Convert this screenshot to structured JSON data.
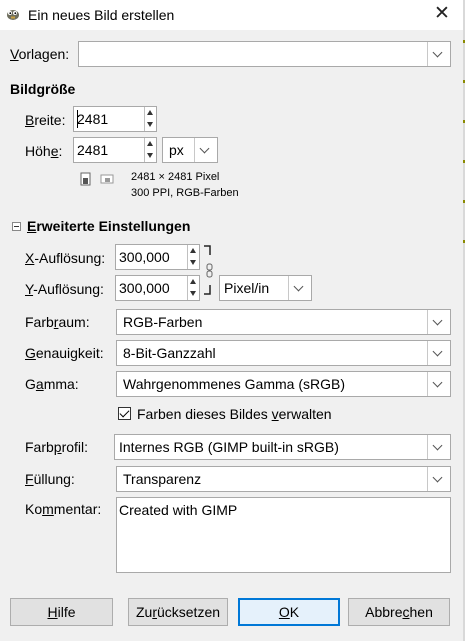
{
  "window": {
    "title": "Ein neues Bild erstellen"
  },
  "template": {
    "label_prefix": "V",
    "label_rest": "orlagen:",
    "value": ""
  },
  "image_size": {
    "heading": "Bildgröße",
    "width_label_prefix": "B",
    "width_label_rest": "reite:",
    "width_value": "2481",
    "height_label_prefix": "Höh",
    "height_label_mid": "e",
    "height_label_rest": ":",
    "height_value": "2481",
    "unit": "px",
    "info_line1": "2481 × 2481 Pixel",
    "info_line2": "300 PPI, RGB-Farben"
  },
  "advanced": {
    "heading_prefix": "E",
    "heading_rest": "rweiterte Einstellungen",
    "xres_label_prefix": "X",
    "xres_label_rest": "-Auflösung:",
    "xres_value": "300,000",
    "yres_label_prefix": "Y",
    "yres_label_rest": "-Auflösung:",
    "yres_value": "300,000",
    "res_unit": "Pixel/in",
    "colorspace_label_a": "Farb",
    "colorspace_label_u": "r",
    "colorspace_label_b": "aum:",
    "colorspace_value": "RGB-Farben",
    "precision_label_u": "G",
    "precision_label_rest": "enauigkeit:",
    "precision_value": "8-Bit-Ganzzahl",
    "gamma_label_a": "G",
    "gamma_label_u": "a",
    "gamma_label_b": "mma:",
    "gamma_value": "Wahrgenommenes Gamma (sRGB)",
    "manage_a": "Farben dieses Bildes ",
    "manage_u": "v",
    "manage_b": "erwalten",
    "profile_label_a": "Farb",
    "profile_label_u": "p",
    "profile_label_b": "rofil:",
    "profile_value": "Internes RGB (GIMP built-in sRGB)",
    "fill_label_u": "F",
    "fill_label_rest": "üllung:",
    "fill_value": "Transparenz",
    "comment_label_a": "Ko",
    "comment_label_u": "m",
    "comment_label_b": "mentar:",
    "comment_value": "Created with GIMP"
  },
  "buttons": {
    "help_u": "H",
    "help_rest": "ilfe",
    "reset_a": "Zu",
    "reset_u": "r",
    "reset_b": "ücksetzen",
    "ok_u": "O",
    "ok_rest": "K",
    "cancel_a": "Abbre",
    "cancel_u": "c",
    "cancel_b": "hen"
  },
  "icons": [
    "gimp-icon",
    "close-icon",
    "portrait-icon",
    "landscape-icon",
    "chain-icon",
    "chevron-down-icon",
    "checkbox-checked-icon",
    "expander-minus-icon"
  ]
}
